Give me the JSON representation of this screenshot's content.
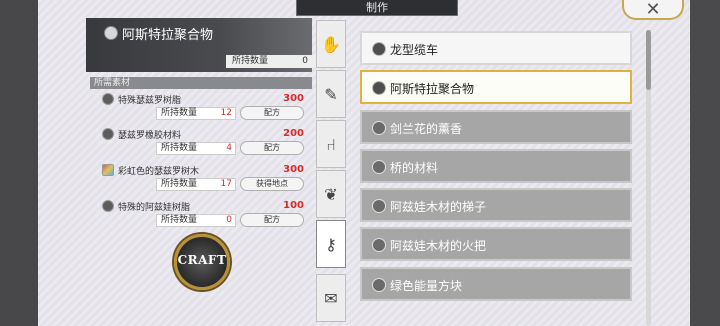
{
  "window": {
    "title": "制作",
    "close_label": "✕"
  },
  "selected_item": {
    "name": "阿斯特拉聚合物",
    "owned_label": "所持数量",
    "owned_value": "0"
  },
  "materials": {
    "section_label": "所需素材",
    "items": [
      {
        "name": "特殊瑟兹罗树脂",
        "required": "300",
        "owned_label": "所持数量",
        "owned": "12",
        "button": "配方",
        "icon": "resin-icon"
      },
      {
        "name": "瑟兹罗橡胶材料",
        "required": "200",
        "owned_label": "所持数量",
        "owned": "4",
        "button": "配方",
        "icon": "rubber-icon"
      },
      {
        "name": "彩虹色的瑟兹罗树木",
        "required": "300",
        "owned_label": "所持数量",
        "owned": "17",
        "button": "获得地点",
        "icon": "rainbow-wood-icon"
      },
      {
        "name": "特殊的阿兹娃树脂",
        "required": "100",
        "owned_label": "所持数量",
        "owned": "0",
        "button": "配方",
        "icon": "resin-icon"
      }
    ]
  },
  "craft_label": "CRAFT",
  "tabs": [
    {
      "icon": "glove-icon",
      "glyph": "✋"
    },
    {
      "icon": "tool-icon",
      "glyph": "✎"
    },
    {
      "icon": "chair-icon",
      "glyph": "⑁"
    },
    {
      "icon": "plant-icon",
      "glyph": "❦"
    },
    {
      "icon": "key-icon",
      "glyph": "⚷"
    },
    {
      "icon": "scroll-icon",
      "glyph": "✉"
    }
  ],
  "recipes": [
    {
      "name": "龙型缆车",
      "state": "unlocked"
    },
    {
      "name": "阿斯特拉聚合物",
      "state": "selected"
    },
    {
      "name": "剑兰花的薰香",
      "state": "locked"
    },
    {
      "name": "桥的材料",
      "state": "locked"
    },
    {
      "name": "阿兹娃木材的梯子",
      "state": "locked"
    },
    {
      "name": "阿兹娃木材的火把",
      "state": "locked"
    },
    {
      "name": "绿色能量方块",
      "state": "locked"
    }
  ],
  "colors": {
    "accent": "#e0b040",
    "required_text": "#d42b2b"
  }
}
